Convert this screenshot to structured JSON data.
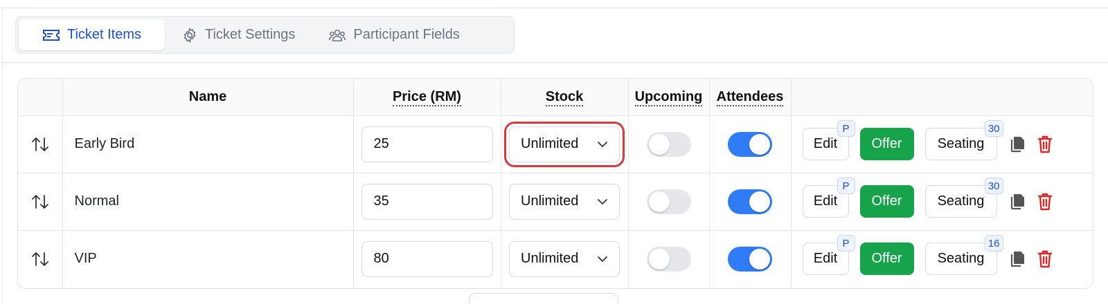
{
  "tabs": [
    {
      "label": "Ticket Items",
      "icon": "ticket-icon",
      "active": true
    },
    {
      "label": "Ticket Settings",
      "icon": "gear-icon",
      "active": false
    },
    {
      "label": "Participant Fields",
      "icon": "users-icon",
      "active": false
    }
  ],
  "table": {
    "headers": {
      "sort": "",
      "name": "Name",
      "price": "Price (RM)",
      "stock": "Stock",
      "upcoming": "Upcoming",
      "attendees": "Attendees",
      "actions": ""
    },
    "rows": [
      {
        "name": "Early Bird",
        "price": "25",
        "stock": "Unlimited",
        "upcoming": false,
        "attendees": true,
        "edit_label": "Edit",
        "edit_badge": "P",
        "offer_label": "Offer",
        "seating_label": "Seating",
        "seating_badge": "30"
      },
      {
        "name": "Normal",
        "price": "35",
        "stock": "Unlimited",
        "upcoming": false,
        "attendees": true,
        "edit_label": "Edit",
        "edit_badge": "P",
        "offer_label": "Offer",
        "seating_label": "Seating",
        "seating_badge": "30"
      },
      {
        "name": "VIP",
        "price": "80",
        "stock": "Unlimited",
        "upcoming": false,
        "attendees": true,
        "edit_label": "Edit",
        "edit_badge": "P",
        "offer_label": "Offer",
        "seating_label": "Seating",
        "seating_badge": "16"
      }
    ]
  },
  "colors": {
    "accent": "#1d4ed8",
    "toggle_on": "#2f7cf6",
    "offer_green": "#16a34a",
    "delete_red": "#dc2626",
    "highlight": "#d9393e"
  }
}
